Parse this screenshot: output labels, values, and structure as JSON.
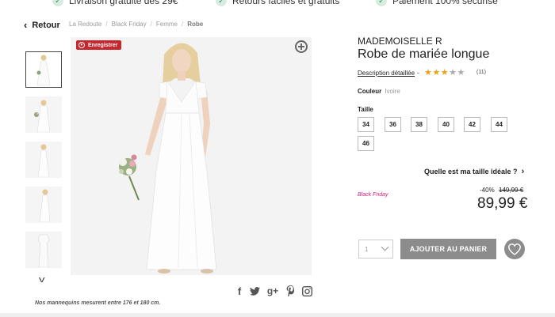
{
  "topbar": {
    "items": [
      "Livraison gratuite dès 29€",
      "Retours faciles et gratuits",
      "Paiement 100% sécurisé"
    ]
  },
  "nav": {
    "back_label": "Retour",
    "breadcrumbs": [
      "La Redoute",
      "Black Friday",
      "Femme",
      "Robe"
    ]
  },
  "gallery": {
    "save_label": "Enregistrer",
    "footnote": "Nos mannequins mesurent entre 176 et 180 cm.",
    "thumbnail_count": 5
  },
  "social": {
    "facebook": "f",
    "googleplus": "g+"
  },
  "product": {
    "brand": "MADEMOISELLE R",
    "title": "Robe de mariée longue",
    "description_link": "Description détaillée",
    "rating": 3,
    "rating_max": 5,
    "reviews": "(11)",
    "color_label": "Couleur",
    "color_value": "Ivoire",
    "size_label": "Taille",
    "sizes": [
      "34",
      "36",
      "38",
      "40",
      "42",
      "44",
      "46"
    ],
    "size_guide": "Quelle est ma taille idéale ?",
    "promo_label": "Black Friday",
    "discount": "-40%",
    "old_price": "149,99 €",
    "price": "89,99 €"
  },
  "cart": {
    "quantity": "1",
    "add_label": "AJOUTER AU PANIER"
  },
  "colors": {
    "accent_red": "#c8262e",
    "promo_pink": "#d11f7a",
    "star_gold": "#e8a317",
    "button_grey": "#8c8c8c"
  }
}
